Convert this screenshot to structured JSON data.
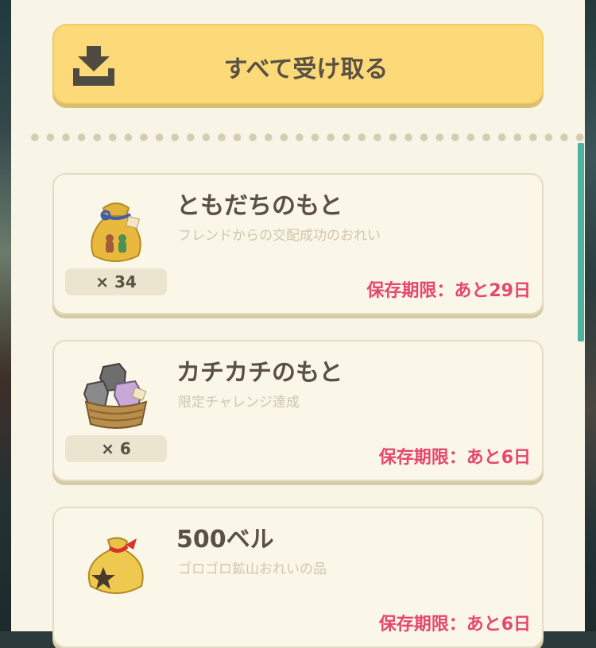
{
  "claim_all": {
    "label": "すべて受け取る",
    "icon": "download-tray-icon"
  },
  "items": [
    {
      "name": "ともだちのもと",
      "description": "フレンドからの交配成功のおれい",
      "quantity": "× 34",
      "expiry": "保存期限：あと29日",
      "icon": "friend-essence-bag-icon"
    },
    {
      "name": "カチカチのもと",
      "description": "限定チャレンジ達成",
      "quantity": "× 6",
      "expiry": "保存期限：あと6日",
      "icon": "stone-essence-basket-icon"
    },
    {
      "name": "500ベル",
      "description": "ゴロゴロ鉱山おれいの品",
      "quantity": "",
      "expiry": "保存期限：あと6日",
      "icon": "bell-bag-icon"
    }
  ],
  "colors": {
    "button": "#fcd979",
    "expiry": "#e6476a",
    "scrollbar": "#4fb1a0",
    "panel": "#f8f4e6"
  }
}
